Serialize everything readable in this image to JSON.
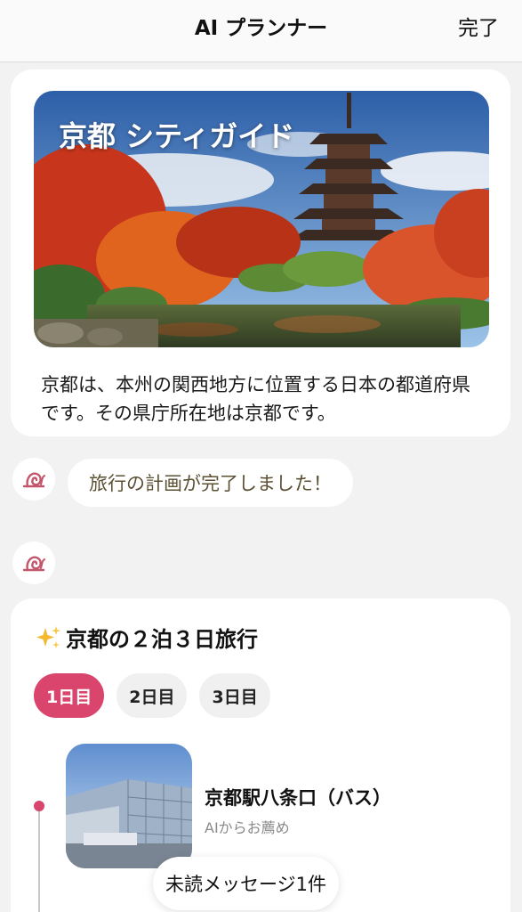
{
  "header": {
    "title": "AI プランナー",
    "done_label": "完了"
  },
  "guide": {
    "title": "京都 シティガイド",
    "description": "京都は、本州の関西地方に位置する日本の都道府県です。その県庁所在地は京都です。",
    "hero_image": "five-story-pagoda-autumn-maples"
  },
  "chat": {
    "avatar_icon": "snail-icon",
    "message": "旅行の計画が完了しました！"
  },
  "plan": {
    "title": "京都の２泊３日旅行",
    "title_icon": "sparkles-icon",
    "tabs": [
      {
        "label": "1日目",
        "active": true
      },
      {
        "label": "2日目",
        "active": false
      },
      {
        "label": "3日目",
        "active": false
      }
    ],
    "items": [
      {
        "name": "京都駅八条口（バス）",
        "subtitle": "AIからお薦め",
        "thumbnail": "kyoto-station-building"
      }
    ]
  },
  "unread_label": "未読メッセージ1件",
  "colors": {
    "accent": "#d9456c",
    "background": "#f2f2f2",
    "card": "#ffffff",
    "avatar_icon": "#c2566b"
  }
}
